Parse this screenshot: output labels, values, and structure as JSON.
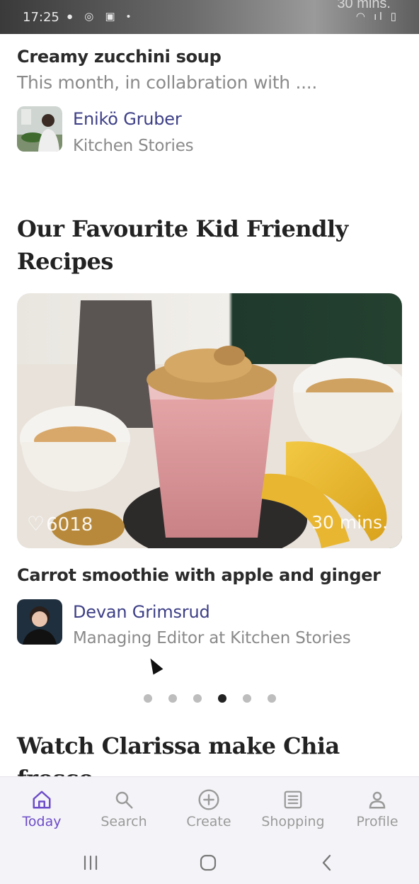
{
  "status_bar": {
    "time": "17:25",
    "left_icons": "● ◎ ▣ •",
    "right_icons": "◠ ıl ▯",
    "overlay_text": "30 mins."
  },
  "first_recipe": {
    "title": "Creamy zucchini soup",
    "subtitle": "This month, in collabration with ....",
    "author_name": "Enikö Gruber",
    "author_role": "Kitchen Stories"
  },
  "section": {
    "title_line1": "Our Favourite Kid Friendly",
    "title_line2": "Recipes"
  },
  "featured": {
    "likes": "6018",
    "duration": "30 mins.",
    "title": "Carrot smoothie with apple and ginger",
    "author_name": "Devan Grimsrud",
    "author_role": "Managing Editor at Kitchen Stories"
  },
  "carousel": {
    "total": 6,
    "active_index": 3
  },
  "next_section": {
    "title_line1": "Watch Clarissa make Chia",
    "title_line2": "frosco"
  },
  "tabs": [
    {
      "label": "Today",
      "icon": "home-icon",
      "active": true
    },
    {
      "label": "Search",
      "icon": "search-icon",
      "active": false
    },
    {
      "label": "Create",
      "icon": "plus-circle-icon",
      "active": false
    },
    {
      "label": "Shopping",
      "icon": "list-icon",
      "active": false
    },
    {
      "label": "Profile",
      "icon": "person-icon",
      "active": false
    }
  ],
  "colors": {
    "accent": "#6c4cc9",
    "author_link": "#3d3f86",
    "muted_text": "#8a8a8a"
  }
}
